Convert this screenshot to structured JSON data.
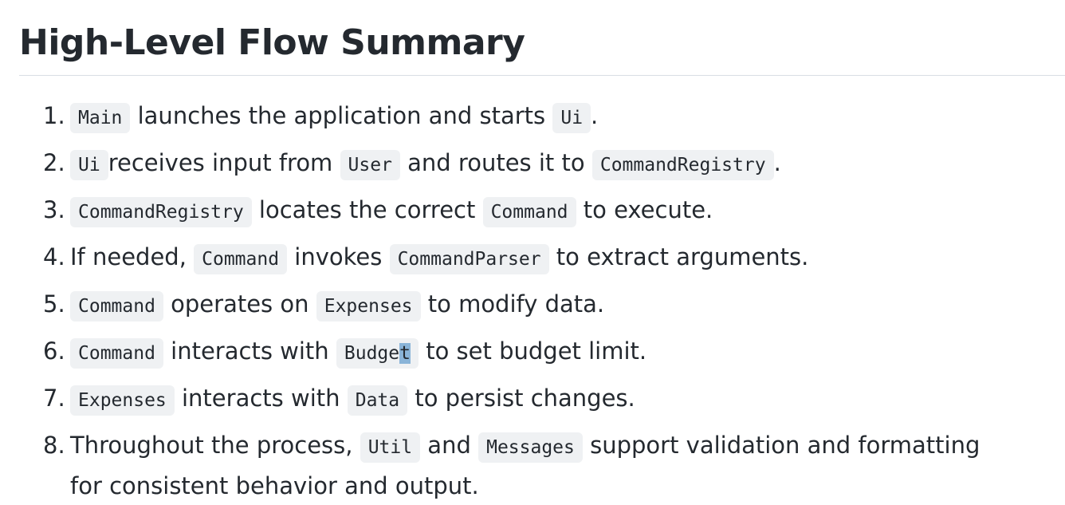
{
  "heading": "High-Level Flow Summary",
  "items": [
    {
      "num": "1.",
      "parts": [
        {
          "code": "Main"
        },
        {
          "text": " launches the application and starts "
        },
        {
          "code": "Ui"
        },
        {
          "text": "."
        }
      ]
    },
    {
      "num": "2.",
      "parts": [
        {
          "code": "Ui"
        },
        {
          "text": "receives input from "
        },
        {
          "code": "User"
        },
        {
          "text": " and routes it to "
        },
        {
          "code": "CommandRegistry"
        },
        {
          "text": "."
        }
      ]
    },
    {
      "num": "3.",
      "parts": [
        {
          "code": "CommandRegistry"
        },
        {
          "text": " locates the correct "
        },
        {
          "code": "Command"
        },
        {
          "text": " to execute."
        }
      ]
    },
    {
      "num": "4.",
      "parts": [
        {
          "text": "If needed, "
        },
        {
          "code": "Command"
        },
        {
          "text": " invokes "
        },
        {
          "code": "CommandParser"
        },
        {
          "text": " to extract arguments."
        }
      ]
    },
    {
      "num": "5.",
      "parts": [
        {
          "code": "Command"
        },
        {
          "text": " operates on "
        },
        {
          "code": "Expenses"
        },
        {
          "text": " to modify data."
        }
      ]
    },
    {
      "num": "6.",
      "parts": [
        {
          "code": "Command"
        },
        {
          "text": " interacts with "
        },
        {
          "code": "Budget"
        },
        {
          "text": " to set budget limit."
        }
      ]
    },
    {
      "num": "7.",
      "parts": [
        {
          "code": "Expenses"
        },
        {
          "text": " interacts with "
        },
        {
          "code": "Data"
        },
        {
          "text": " to persist changes."
        }
      ]
    },
    {
      "num": "8.",
      "parts": [
        {
          "text": "Throughout the process, "
        },
        {
          "code": "Util"
        },
        {
          "text": " and "
        },
        {
          "code": "Messages"
        },
        {
          "text": " support validation and formatting for consistent behavior and output."
        }
      ]
    }
  ],
  "selection": {
    "item": 5,
    "part": 2,
    "char_index": 5,
    "color": "#8ab4d8"
  },
  "colors": {
    "text": "#24292f",
    "code_bg": "#eff1f3",
    "rule": "#d8dee4"
  }
}
